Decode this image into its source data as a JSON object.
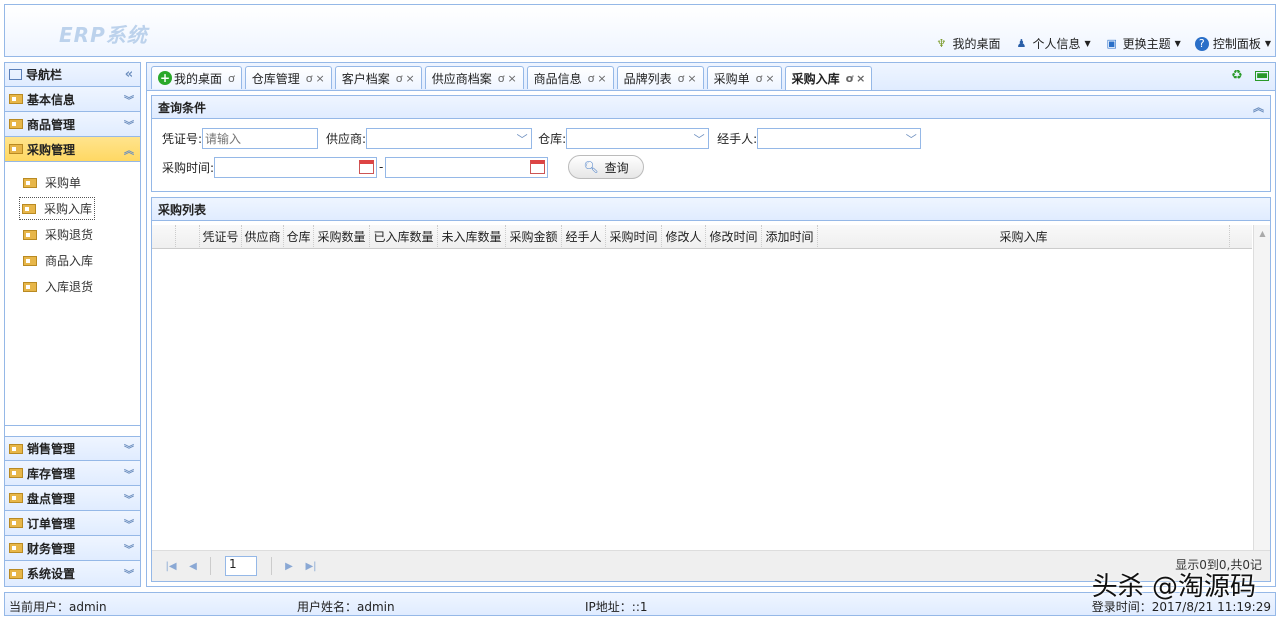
{
  "header": {
    "logo": "ERP系统",
    "menu": [
      {
        "label": "我的桌面",
        "icon": "desktop-icon",
        "dropdown": false
      },
      {
        "label": "个人信息",
        "icon": "user-icon",
        "dropdown": true
      },
      {
        "label": "更换主题",
        "icon": "theme-icon",
        "dropdown": true
      },
      {
        "label": "控制面板",
        "icon": "help-icon",
        "dropdown": true
      }
    ]
  },
  "nav": {
    "title": "导航栏",
    "groups_top": [
      "基本信息",
      "商品管理",
      "采购管理"
    ],
    "active_group": "采购管理",
    "sub_items": [
      "采购单",
      "采购入库",
      "采购退货",
      "商品入库",
      "入库退货"
    ],
    "selected_item": "采购入库",
    "groups_bottom": [
      "销售管理",
      "库存管理",
      "盘点管理",
      "订单管理",
      "财务管理",
      "系统设置"
    ]
  },
  "tabs": [
    {
      "label": "我的桌面",
      "closable": false
    },
    {
      "label": "仓库管理",
      "closable": true
    },
    {
      "label": "客户档案",
      "closable": true
    },
    {
      "label": "供应商档案",
      "closable": true
    },
    {
      "label": "商品信息",
      "closable": true
    },
    {
      "label": "品牌列表",
      "closable": true
    },
    {
      "label": "采购单",
      "closable": true
    },
    {
      "label": "采购入库",
      "closable": true
    }
  ],
  "active_tab": "采购入库",
  "query": {
    "title": "查询条件",
    "voucher_label": "凭证号:",
    "voucher_placeholder": "请输入",
    "supplier_label": "供应商:",
    "warehouse_label": "仓库:",
    "handler_label": "经手人:",
    "time_label": "采购时间:",
    "time_sep": "-",
    "search_button": "查询"
  },
  "list": {
    "title": "采购列表",
    "columns": [
      "凭证号",
      "供应商",
      "仓库",
      "采购数量",
      "已入库数量",
      "未入库数量",
      "采购金额",
      "经手人",
      "采购时间",
      "修改人",
      "修改时间",
      "添加时间",
      "采购入库"
    ],
    "rows": [],
    "pager": {
      "page": "1",
      "info": "显示0到0,共0记"
    }
  },
  "status": {
    "current_user": "当前用户：admin",
    "user_name": "用户姓名：admin",
    "ip": "IP地址：::1",
    "login_time": "登录时间：2017/8/21 11:19:29"
  },
  "watermark": "头杀 @淘源码",
  "colors": {
    "border": "#95b8e7",
    "header_bg": "#e0ecff",
    "active_group": "#ffd863"
  }
}
